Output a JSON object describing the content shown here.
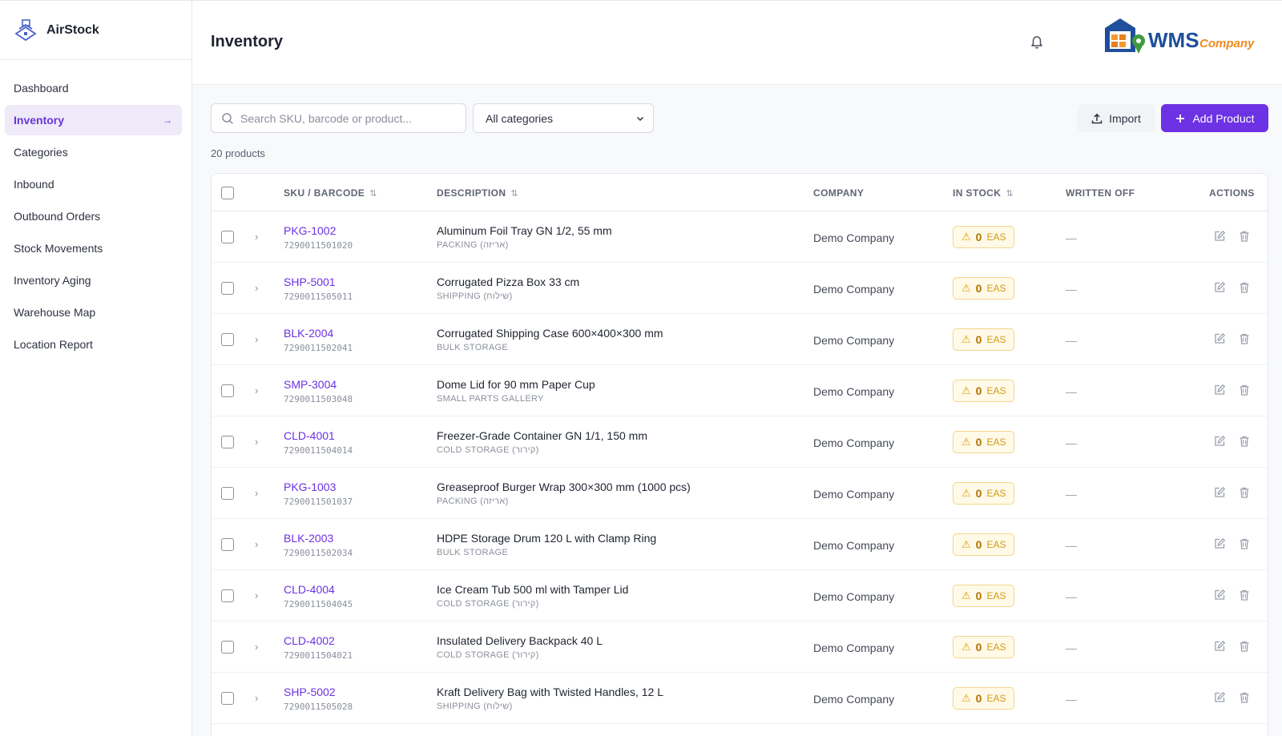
{
  "app": {
    "name": "AirStock"
  },
  "sidebar": {
    "items": [
      {
        "label": "Dashboard",
        "active": false
      },
      {
        "label": "Inventory",
        "active": true
      },
      {
        "label": "Categories",
        "active": false
      },
      {
        "label": "Inbound",
        "active": false
      },
      {
        "label": "Outbound Orders",
        "active": false
      },
      {
        "label": "Stock Movements",
        "active": false
      },
      {
        "label": "Inventory Aging",
        "active": false
      },
      {
        "label": "Warehouse Map",
        "active": false
      },
      {
        "label": "Location Report",
        "active": false
      }
    ],
    "active_arrow": "→"
  },
  "header": {
    "title": "Inventory",
    "logo_text": "WMS",
    "logo_subtext": "Company"
  },
  "toolbar": {
    "search_placeholder": "Search SKU, barcode or product...",
    "category_selected": "All categories",
    "import_label": "Import",
    "add_label": "Add Product",
    "count_text": "20 products"
  },
  "table": {
    "headers": {
      "sku": "SKU / BARCODE",
      "description": "DESCRIPTION",
      "company": "COMPANY",
      "in_stock": "IN STOCK",
      "written_off": "WRITTEN OFF",
      "actions": "ACTIONS"
    },
    "rows": [
      {
        "sku": "PKG-1002",
        "barcode": "7290011501020",
        "description": "Aluminum Foil Tray GN 1/2, 55 mm",
        "category": "PACKING (אריזה)",
        "company": "Demo Company",
        "stock": "0",
        "unit": "EAS",
        "written_off": "—"
      },
      {
        "sku": "SHP-5001",
        "barcode": "7290011505011",
        "description": "Corrugated Pizza Box 33 cm",
        "category": "SHIPPING (שילוח)",
        "company": "Demo Company",
        "stock": "0",
        "unit": "EAS",
        "written_off": "—"
      },
      {
        "sku": "BLK-2004",
        "barcode": "7290011502041",
        "description": "Corrugated Shipping Case 600×400×300 mm",
        "category": "BULK STORAGE",
        "company": "Demo Company",
        "stock": "0",
        "unit": "EAS",
        "written_off": "—"
      },
      {
        "sku": "SMP-3004",
        "barcode": "7290011503048",
        "description": "Dome Lid for 90 mm Paper Cup",
        "category": "SMALL PARTS GALLERY",
        "company": "Demo Company",
        "stock": "0",
        "unit": "EAS",
        "written_off": "—"
      },
      {
        "sku": "CLD-4001",
        "barcode": "7290011504014",
        "description": "Freezer-Grade Container GN 1/1, 150 mm",
        "category": "COLD STORAGE (קירור)",
        "company": "Demo Company",
        "stock": "0",
        "unit": "EAS",
        "written_off": "—"
      },
      {
        "sku": "PKG-1003",
        "barcode": "7290011501037",
        "description": "Greaseproof Burger Wrap 300×300 mm (1000 pcs)",
        "category": "PACKING (אריזה)",
        "company": "Demo Company",
        "stock": "0",
        "unit": "EAS",
        "written_off": "—"
      },
      {
        "sku": "BLK-2003",
        "barcode": "7290011502034",
        "description": "HDPE Storage Drum 120 L with Clamp Ring",
        "category": "BULK STORAGE",
        "company": "Demo Company",
        "stock": "0",
        "unit": "EAS",
        "written_off": "—"
      },
      {
        "sku": "CLD-4004",
        "barcode": "7290011504045",
        "description": "Ice Cream Tub 500 ml with Tamper Lid",
        "category": "COLD STORAGE (קירור)",
        "company": "Demo Company",
        "stock": "0",
        "unit": "EAS",
        "written_off": "—"
      },
      {
        "sku": "CLD-4002",
        "barcode": "7290011504021",
        "description": "Insulated Delivery Backpack 40 L",
        "category": "COLD STORAGE (קירור)",
        "company": "Demo Company",
        "stock": "0",
        "unit": "EAS",
        "written_off": "—"
      },
      {
        "sku": "SHP-5002",
        "barcode": "7290011505028",
        "description": "Kraft Delivery Bag with Twisted Handles, 12 L",
        "category": "SHIPPING (שילוח)",
        "company": "Demo Company",
        "stock": "0",
        "unit": "EAS",
        "written_off": "—"
      }
    ]
  },
  "colors": {
    "accent": "#6d32e3",
    "warning": "#e0a100",
    "sidebar_active_bg": "#eeeaf9"
  },
  "icons": [
    "brand-logo-icon",
    "bell-icon",
    "search-icon",
    "chevron-down-icon",
    "upload-icon",
    "plus-icon",
    "sort-icon",
    "chevron-right-icon",
    "warning-icon",
    "edit-icon",
    "trash-icon",
    "arrow-right-icon"
  ]
}
